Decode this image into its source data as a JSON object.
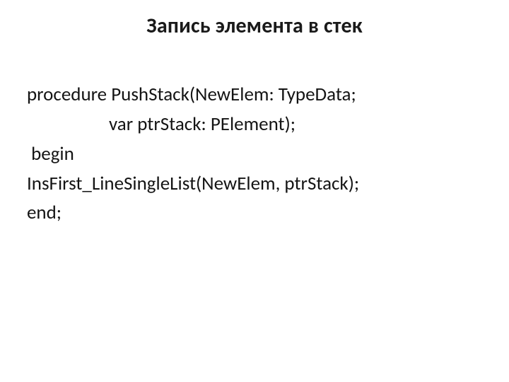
{
  "title": "Запись элемента в стек",
  "code": {
    "l1": "procedure PushStack(NewElem: TypeData;",
    "l2": "                   var ptrStack: PElement);",
    "l3": " begin",
    "l4": "InsFirst_LineSingleList(NewElem, ptrStack);",
    "l5": "end;"
  }
}
